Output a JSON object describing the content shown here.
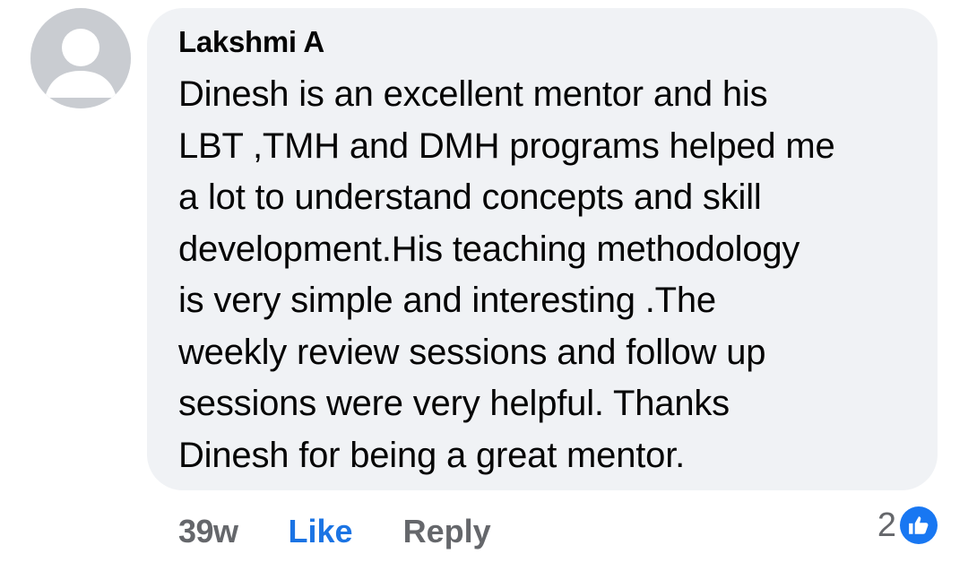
{
  "comment": {
    "author": "Lakshmi A",
    "text": "Dinesh is an excellent mentor and his\nLBT ,TMH and DMH programs helped me\na lot to understand concepts and skill\ndevelopment.His teaching methodology\nis very simple and interesting .The\nweekly review sessions and follow up\nsessions were very helpful. Thanks\nDinesh for being a great mentor.",
    "time": "39w",
    "like_label": "Like",
    "reply_label": "Reply",
    "reaction_count": "2",
    "reaction_icon": "thumbs-up-icon"
  },
  "colors": {
    "bubble": "#f0f2f5",
    "text": "#050505",
    "muted": "#65676b",
    "like_blue": "#1b74e4",
    "reaction_blue": "#1877f2"
  }
}
